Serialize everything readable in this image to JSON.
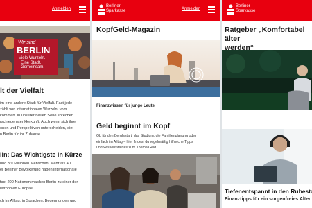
{
  "brand": {
    "name_line1": "Berliner",
    "name_line2": "Sparkasse",
    "accent": "#e8000f"
  },
  "login_label": "Anmelden",
  "panel1": {
    "hero_art_line1": "Wir sind",
    "hero_art_line2": "BERLIN",
    "hero_art_line3": "Viele Wurzeln.",
    "hero_art_line4": "Eine Stadt.",
    "hero_art_line5": "Gemeinsam.",
    "title": "lt der Vielfalt",
    "intro": [
      "im eine andere Stadt für Vielfalt. Fast jede",
      "zählt von internationalen Wurzeln, vom",
      "kommen. In unserer neuen Serie sprechen",
      "rschiedenster Herkunft. Auch wenn sich ihre",
      "onen und Perspektiven unterscheiden, eint",
      "n Berlin für ihr Zuhause."
    ],
    "subtitle": "lin: Das Wichtigste in Kürze",
    "facts": [
      "und 3,9 Millionen Menschen. Mehr als 40",
      "er Berliner Bevölkerung haben internationale",
      "",
      "fast 200 Nationen machen Berlin zu einer der",
      "letropolen Europas.",
      "",
      "ch im Alltag: in Sprachen, Begegnungen und"
    ]
  },
  "panel2": {
    "title": "KopfGeld-Magazin",
    "tagline": "Finanzwissen für junge Leute",
    "section_title": "Geld beginnt im Kopf",
    "section_text": [
      "Ob für den Berufsstart, das Studium, die Familienplanung oder",
      "einfach im Alltag – hier findest du regelmäßig hilfreiche Tipps",
      "und Wissenswertes zum Thema Geld."
    ]
  },
  "panel3": {
    "title_line1": "Ratgeber „Komfortabel älter",
    "title_line2": "werden“",
    "article_title": "Tiefenentspannt in den Ruhestan",
    "article_sub": "Finanztipps für ein sorgenfreies Alter"
  }
}
